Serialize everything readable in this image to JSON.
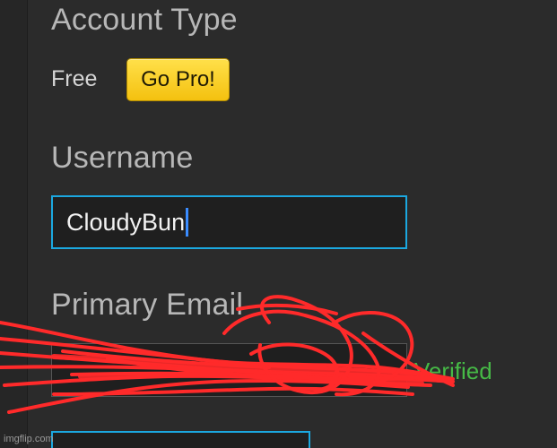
{
  "account": {
    "heading": "Account Type",
    "plan": "Free",
    "upgrade_label": "Go Pro!"
  },
  "username": {
    "heading": "Username",
    "value": "CloudyBun"
  },
  "email": {
    "heading": "Primary Email",
    "value": "",
    "status": "Verified"
  },
  "watermark": "imgflip.com",
  "colors": {
    "accent": "#1ba8e0",
    "button": "#f7c61a",
    "verified": "#46b946",
    "redaction": "#ff2a2a"
  }
}
